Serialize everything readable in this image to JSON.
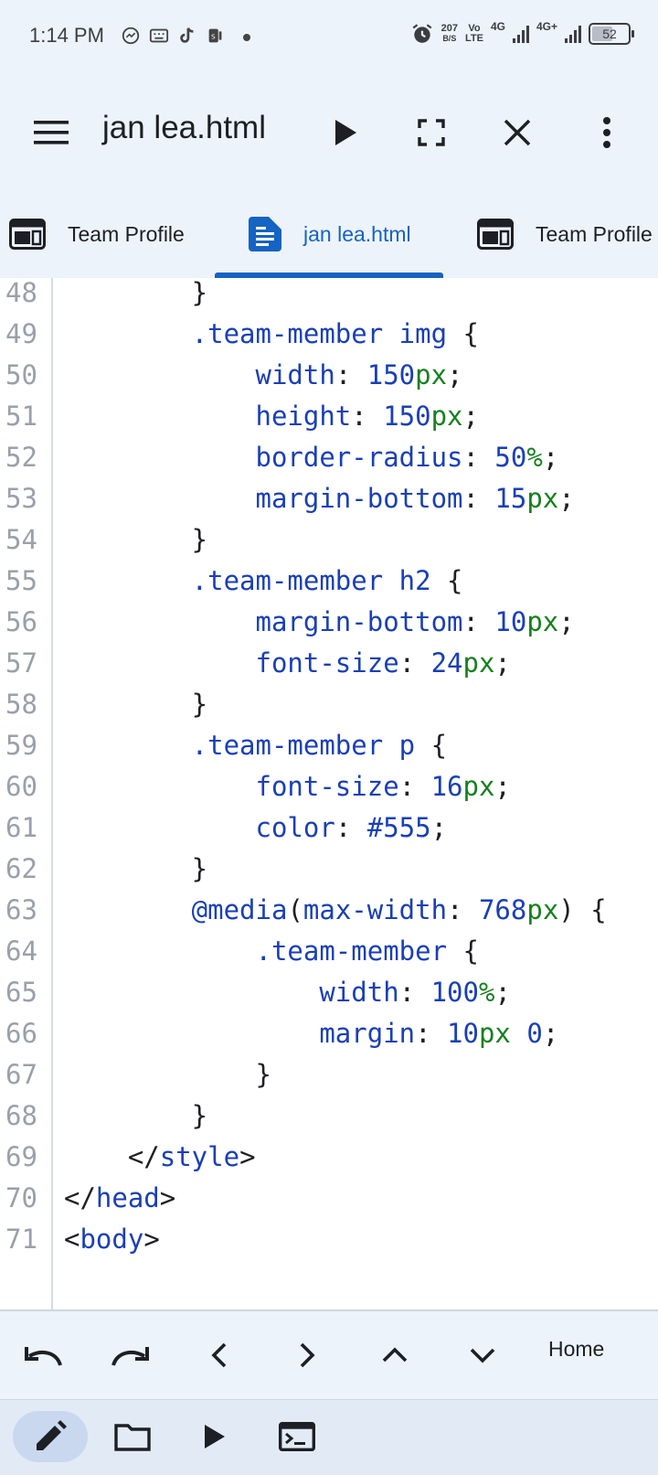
{
  "status_bar": {
    "time": "1:14 PM",
    "net_speed_value": "207",
    "net_speed_unit": "B/S",
    "volte_top": "Vo",
    "volte_bottom": "LTE",
    "sim1_label": "4G",
    "sim2_label": "4G+",
    "battery": "52",
    "left_icons": [
      "messenger-icon",
      "keyboard-icon",
      "tiktok-icon",
      "sim-toolkit-icon"
    ],
    "right_icons": [
      "alarm-icon"
    ]
  },
  "toolbar": {
    "title": "jan lea.html",
    "icons": [
      "menu-icon",
      "run-icon",
      "fullscreen-icon",
      "close-icon",
      "more-vert-icon"
    ]
  },
  "tabs": [
    {
      "label": "Team Profile",
      "icon": "web-preview-icon",
      "active": false
    },
    {
      "label": "jan lea.html",
      "icon": "document-icon",
      "active": true
    },
    {
      "label": "Team Profile",
      "icon": "web-preview-icon",
      "active": false
    }
  ],
  "editor": {
    "lines": [
      {
        "n": "48",
        "tokens": [
          [
            "punc",
            "        }"
          ]
        ]
      },
      {
        "n": "49",
        "tokens": [
          [
            "sel",
            "        .team-member img "
          ],
          [
            "punc",
            "{"
          ]
        ]
      },
      {
        "n": "50",
        "tokens": [
          [
            "prop",
            "            width"
          ],
          [
            "punc",
            ": "
          ],
          [
            "num",
            "150"
          ],
          [
            "unit",
            "px"
          ],
          [
            "punc",
            ";"
          ]
        ]
      },
      {
        "n": "51",
        "tokens": [
          [
            "prop",
            "            height"
          ],
          [
            "punc",
            ": "
          ],
          [
            "num",
            "150"
          ],
          [
            "unit",
            "px"
          ],
          [
            "punc",
            ";"
          ]
        ]
      },
      {
        "n": "52",
        "tokens": [
          [
            "prop",
            "            border-radius"
          ],
          [
            "punc",
            ": "
          ],
          [
            "num",
            "50"
          ],
          [
            "unit",
            "%"
          ],
          [
            "punc",
            ";"
          ]
        ]
      },
      {
        "n": "53",
        "tokens": [
          [
            "prop",
            "            margin-bottom"
          ],
          [
            "punc",
            ": "
          ],
          [
            "num",
            "15"
          ],
          [
            "unit",
            "px"
          ],
          [
            "punc",
            ";"
          ]
        ]
      },
      {
        "n": "54",
        "tokens": [
          [
            "punc",
            "        }"
          ]
        ]
      },
      {
        "n": "55",
        "tokens": [
          [
            "sel",
            "        .team-member h2 "
          ],
          [
            "punc",
            "{"
          ]
        ]
      },
      {
        "n": "56",
        "tokens": [
          [
            "prop",
            "            margin-bottom"
          ],
          [
            "punc",
            ": "
          ],
          [
            "num",
            "10"
          ],
          [
            "unit",
            "px"
          ],
          [
            "punc",
            ";"
          ]
        ]
      },
      {
        "n": "57",
        "tokens": [
          [
            "prop",
            "            font-size"
          ],
          [
            "punc",
            ": "
          ],
          [
            "num",
            "24"
          ],
          [
            "unit",
            "px"
          ],
          [
            "punc",
            ";"
          ]
        ]
      },
      {
        "n": "58",
        "tokens": [
          [
            "punc",
            "        }"
          ]
        ]
      },
      {
        "n": "59",
        "tokens": [
          [
            "sel",
            "        .team-member p "
          ],
          [
            "punc",
            "{"
          ]
        ]
      },
      {
        "n": "60",
        "tokens": [
          [
            "prop",
            "            font-size"
          ],
          [
            "punc",
            ": "
          ],
          [
            "num",
            "16"
          ],
          [
            "unit",
            "px"
          ],
          [
            "punc",
            ";"
          ]
        ]
      },
      {
        "n": "61",
        "tokens": [
          [
            "prop",
            "            color"
          ],
          [
            "punc",
            ": "
          ],
          [
            "num",
            "#555"
          ],
          [
            "punc",
            ";"
          ]
        ]
      },
      {
        "n": "62",
        "tokens": [
          [
            "punc",
            "        }"
          ]
        ]
      },
      {
        "n": "63",
        "tokens": [
          [
            "at",
            "        @media"
          ],
          [
            "punc",
            "("
          ],
          [
            "prop",
            "max-width"
          ],
          [
            "punc",
            ": "
          ],
          [
            "num",
            "768"
          ],
          [
            "unit",
            "px"
          ],
          [
            "punc",
            ") {"
          ]
        ]
      },
      {
        "n": "64",
        "tokens": [
          [
            "sel",
            "            .team-member "
          ],
          [
            "punc",
            "{"
          ]
        ]
      },
      {
        "n": "65",
        "tokens": [
          [
            "prop",
            "                width"
          ],
          [
            "punc",
            ": "
          ],
          [
            "num",
            "100"
          ],
          [
            "unit",
            "%"
          ],
          [
            "punc",
            ";"
          ]
        ]
      },
      {
        "n": "66",
        "tokens": [
          [
            "prop",
            "                margin"
          ],
          [
            "punc",
            ": "
          ],
          [
            "num",
            "10"
          ],
          [
            "unit",
            "px "
          ],
          [
            "num",
            "0"
          ],
          [
            "punc",
            ";"
          ]
        ]
      },
      {
        "n": "67",
        "tokens": [
          [
            "punc",
            "            }"
          ]
        ]
      },
      {
        "n": "68",
        "tokens": [
          [
            "punc",
            "        }"
          ]
        ]
      },
      {
        "n": "69",
        "tokens": [
          [
            "punc",
            "    </"
          ],
          [
            "tag",
            "style"
          ],
          [
            "punc",
            ">"
          ]
        ]
      },
      {
        "n": "70",
        "tokens": [
          [
            "punc",
            "</"
          ],
          [
            "tag",
            "head"
          ],
          [
            "punc",
            ">"
          ]
        ]
      },
      {
        "n": "71",
        "tokens": [
          [
            "punc",
            "<"
          ],
          [
            "tag",
            "body"
          ],
          [
            "punc",
            ">"
          ]
        ]
      }
    ]
  },
  "keybar": {
    "home_label": "Home",
    "icons": [
      "undo-icon",
      "redo-icon",
      "arrow-left-icon",
      "arrow-right-icon",
      "arrow-up-icon",
      "arrow-down-icon"
    ]
  },
  "navbar": {
    "icons": [
      "edit-icon",
      "folder-icon",
      "play-icon",
      "terminal-icon"
    ],
    "active": "edit-icon"
  },
  "colors": {
    "accent": "#1563c2",
    "code_keyword": "#1a3fb5",
    "code_unit": "#16801e",
    "background": "#edf3fb"
  }
}
